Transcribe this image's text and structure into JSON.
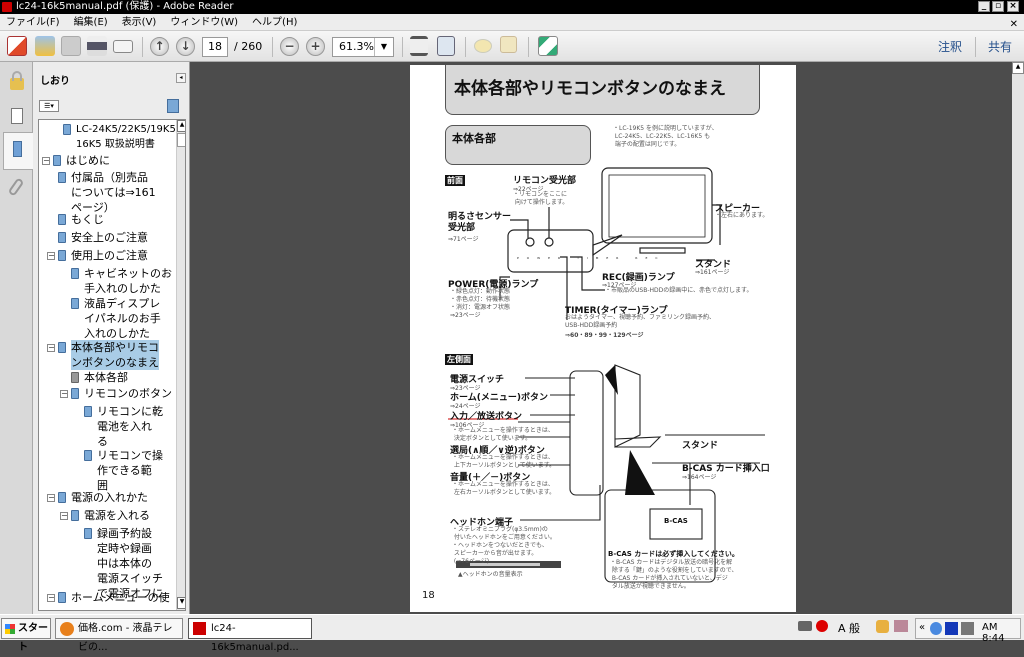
{
  "window": {
    "title": "lc24-16k5manual.pdf (保護) - Adobe Reader"
  },
  "menu": [
    "ファイル(F)",
    "編集(E)",
    "表示(V)",
    "ウィンドウ(W)",
    "ヘルプ(H)"
  ],
  "toolbar": {
    "page_current": "18",
    "page_total": "/ 260",
    "zoom": "61.3%",
    "annotate": "注釈",
    "share": "共有"
  },
  "panel": {
    "title": "しおり"
  },
  "bookmarks": [
    {
      "label": "LC-24K5/22K5/19K5/\n16K5 取扱説明書"
    },
    {
      "label": "はじめに"
    },
    {
      "label": "付属品（別売品\nについては⇒161\nページ）"
    },
    {
      "label": "もくじ"
    },
    {
      "label": "安全上のご注意"
    },
    {
      "label": "使用上のご注意"
    },
    {
      "label": "キャビネットのお\n手入れのしかた"
    },
    {
      "label": "液晶ディスプレ\nイパネルのお手\n入れのしかた"
    },
    {
      "label": "本体各部やリモコ\nンボタンのなまえ"
    },
    {
      "label": "本体各部"
    },
    {
      "label": "リモコンのボタン"
    },
    {
      "label": "リモコンに乾\n電池を入れ\nる"
    },
    {
      "label": "リモコンで操\n作できる範\n囲"
    },
    {
      "label": "電源の入れかた"
    },
    {
      "label": "電源を入れる"
    },
    {
      "label": "録画予約設\n定時や録画\n中は本体の\n電源スイッチ\nで電源オフに"
    },
    {
      "label": "ホームメニューの使"
    }
  ],
  "pdf": {
    "heading": "本体各部やリモコンボタンのなまえ",
    "subheading": "本体各部",
    "note": "・LC-19K5 を例に説明していますが、\n LC-24K5、LC-22K5、LC-16K5 も\n 端子の配置は同じです。",
    "front": "前面",
    "remote_sensor": "リモコン受光部",
    "remote_sensor_ref": "⇒22ページ",
    "remote_sensor_note": "・リモコンをここに\n 向けて操作します。",
    "light_sensor": "明るさセンサー\n受光部",
    "light_sensor_ref": "⇒71ページ",
    "speaker": "スピーカー",
    "speaker_note": "・左右にあります。",
    "stand": "スタンド",
    "stand_ref": "⇒161ページ",
    "panel_labels": [
      "POWER",
      "TIMER",
      "REC"
    ],
    "rec": "REC(録画)ランプ",
    "rec_ref": "⇒127ページ",
    "rec_note": "・市販品のUSB-HDDの録画中に、赤色で点灯します。",
    "power": "POWER(電源)ランプ",
    "power_note": "・緑色点灯：動作状態\n・赤色点灯：待機状態\n・消灯：電源オフ状態",
    "power_ref": "⇒23ページ",
    "timer": "TIMER(タイマー)ランプ",
    "timer_note": "おはようタイマー、視聴予約、ファミリンク録画予約、\nUSB-HDD録画予約",
    "timer_ref": "⇒60・89・99・129ページ",
    "left": "左側面",
    "power_switch": "電源スイッチ",
    "power_switch_ref": "⇒23ページ",
    "home": "ホーム(メニュー)ボタン",
    "home_ref": "⇒24ページ",
    "input": "入力／放送ボタン",
    "input_ref": "⇒106ページ",
    "input_note": "・ホームメニューを操作するときは、\n 決定ボタンとして使います。",
    "channel": "選局(∧順／∨逆)ボタン",
    "channel_note": "・ホームメニューを操作するときは、\n 上下カーソルボタンとして使います。",
    "volume": "音量(＋／－)ボタン",
    "volume_note": "・ホームメニューを操作するときは、\n 左右カーソルボタンとして使います。",
    "stand2": "スタンド",
    "bcas": "B-CAS カード挿入口",
    "bcas_ref": "⇒164ページ",
    "bcas_card": "B-CAS",
    "headphone": "ヘッドホン端子",
    "headphone_note": "・ステレオミニプラグ(φ3.5mm)の\n 付いたヘッドホンをご用意ください。\n・ヘッドホンをつないだときでも、\n スピーカーから音が出せます。\n (⇒76ページ)",
    "hp_caption": "▲ヘッドホンの音量表示",
    "bcas_warn": "B-CAS カードは必ず挿入してください。",
    "bcas_warn_note": "・B-CAS カードはデジタル放送の暗号化を解\n 除する「鍵」のような役割をしていますので、\n B-CAS カードが挿入されていないと、デジ\n タル放送が視聴できません。",
    "page_number": "18"
  },
  "taskbar": {
    "start": "スタート",
    "tasks": [
      "価格.com - 液晶テレビの...",
      "lc24-16k5manual.pd..."
    ],
    "ime": "A 般",
    "clock": "AM 8:44"
  }
}
